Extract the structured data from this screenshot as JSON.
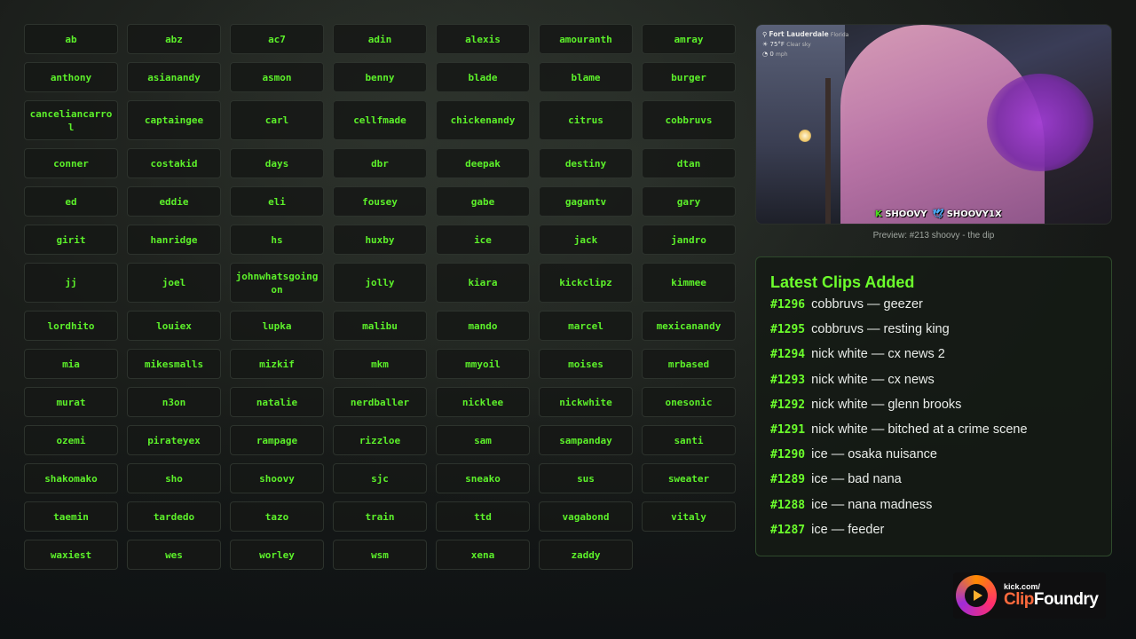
{
  "buttons": [
    "ab",
    "abz",
    "ac7",
    "adin",
    "alexis",
    "amouranth",
    "amray",
    "anthony",
    "asianandy",
    "asmon",
    "benny",
    "blade",
    "blame",
    "burger",
    "canceliancarrol",
    "captaingee",
    "carl",
    "cellfmade",
    "chickenandy",
    "citrus",
    "cobbruvs",
    "conner",
    "costakid",
    "days",
    "dbr",
    "deepak",
    "destiny",
    "dtan",
    "ed",
    "eddie",
    "eli",
    "fousey",
    "gabe",
    "gagantv",
    "gary",
    "girit",
    "hanridge",
    "hs",
    "huxby",
    "ice",
    "jack",
    "jandro",
    "jj",
    "joel",
    "johnwhatsgoingon",
    "jolly",
    "kiara",
    "kickclipz",
    "kimmee",
    "lordhito",
    "louiex",
    "lupka",
    "malibu",
    "mando",
    "marcel",
    "mexicanandy",
    "mia",
    "mikesmalls",
    "mizkif",
    "mkm",
    "mmyoil",
    "moises",
    "mrbased",
    "murat",
    "n3on",
    "natalie",
    "nerdballer",
    "nicklee",
    "nickwhite",
    "onesonic",
    "ozemi",
    "pirateyex",
    "rampage",
    "rizzloe",
    "sam",
    "sampanday",
    "santi",
    "shakomako",
    "sho",
    "shoovy",
    "sjc",
    "sneako",
    "sus",
    "sweater",
    "taemin",
    "tardedo",
    "tazo",
    "train",
    "ttd",
    "vagabond",
    "vitaly",
    "waxiest",
    "wes",
    "worley",
    "wsm",
    "xena",
    "zaddy"
  ],
  "preview": {
    "caption": "Preview: #213 shoovy - the dip",
    "weather_city": "Fort Lauderdale",
    "weather_state": "Florida",
    "weather_temp": "75°F",
    "weather_desc": "Clear sky",
    "weather_wind": "0",
    "weather_wind_unit": "mph",
    "handle_kick": "SHOOVY",
    "handle_twitter": "SHOOVY1X"
  },
  "latest": {
    "title": "Latest Clips Added",
    "clips": [
      {
        "num": "#1296",
        "text": "cobbruvs — geezer"
      },
      {
        "num": "#1295",
        "text": "cobbruvs — resting king"
      },
      {
        "num": "#1294",
        "text": "nick white — cx news 2"
      },
      {
        "num": "#1293",
        "text": "nick white — cx news"
      },
      {
        "num": "#1292",
        "text": "nick white — glenn brooks"
      },
      {
        "num": "#1291",
        "text": "nick white — bitched at a crime scene"
      },
      {
        "num": "#1290",
        "text": "ice — osaka nuisance"
      },
      {
        "num": "#1289",
        "text": "ice — bad nana"
      },
      {
        "num": "#1288",
        "text": "ice — nana madness"
      },
      {
        "num": "#1287",
        "text": "ice — feeder"
      }
    ]
  },
  "logo": {
    "small": "kick.com/",
    "clip": "Clip",
    "foundry": "Foundry"
  },
  "colors": {
    "accent": "#5cf02a",
    "title_green": "#6cff2c"
  }
}
